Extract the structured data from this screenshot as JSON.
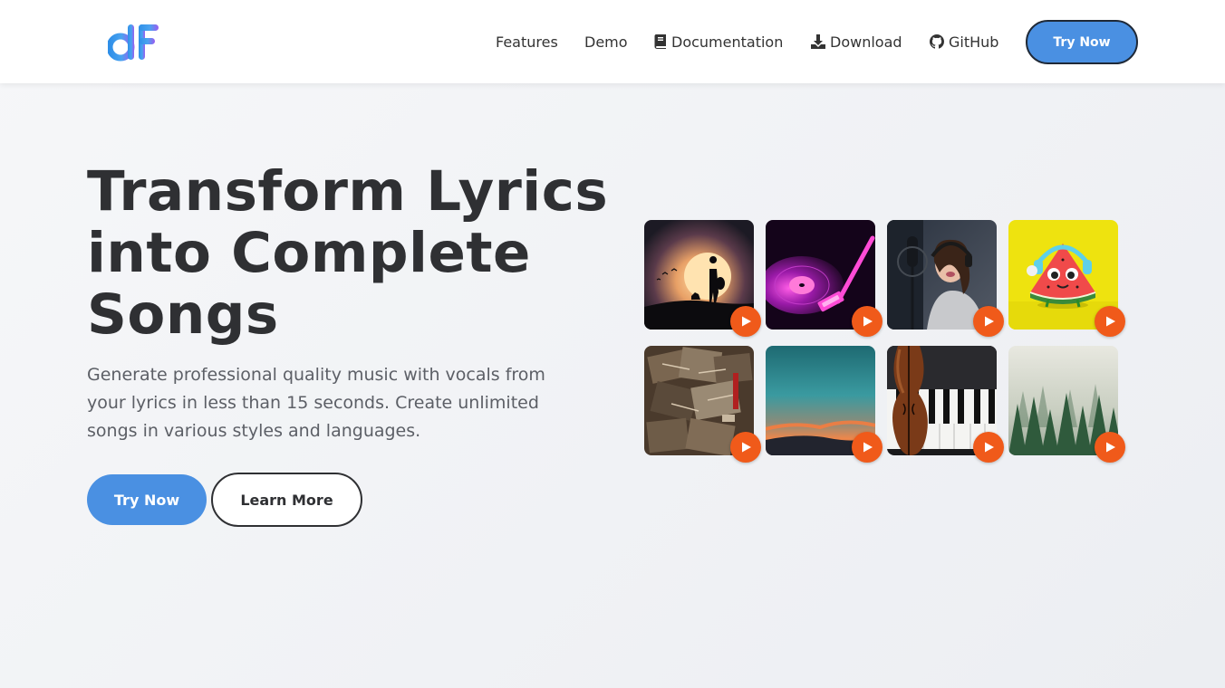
{
  "header": {
    "logo_text": "dF",
    "nav": [
      {
        "label": "Features",
        "icon": ""
      },
      {
        "label": "Demo",
        "icon": ""
      },
      {
        "label": "Documentation",
        "icon": "book-icon"
      },
      {
        "label": "Download",
        "icon": "download-icon"
      },
      {
        "label": "GitHub",
        "icon": "github-icon"
      }
    ],
    "cta_label": "Try Now"
  },
  "hero": {
    "title_lines": [
      "Transform Lyrics",
      "into Complete",
      "Songs"
    ],
    "subtitle_lines": [
      "Generate professional quality music with vocals from",
      "your lyrics in less than 15 seconds. Create unlimited",
      "songs in various styles and languages."
    ],
    "primary_button": "Try Now",
    "secondary_button": "Learn More"
  },
  "gallery": {
    "tiles": [
      {
        "name": "sunset-guitarist",
        "icon": "play-icon"
      },
      {
        "name": "neon-vinyl",
        "icon": "play-icon"
      },
      {
        "name": "studio-singer",
        "icon": "play-icon"
      },
      {
        "name": "watermelon-character",
        "icon": "play-icon"
      },
      {
        "name": "cd-stack",
        "icon": "play-icon"
      },
      {
        "name": "teal-sunset-sky",
        "icon": "play-icon"
      },
      {
        "name": "violin-piano",
        "icon": "play-icon"
      },
      {
        "name": "misty-forest",
        "icon": "play-icon"
      }
    ]
  },
  "colors": {
    "accent": "#4a90e2",
    "play": "#f05a1a",
    "text": "#2f3033",
    "muted": "#5c5f66"
  }
}
